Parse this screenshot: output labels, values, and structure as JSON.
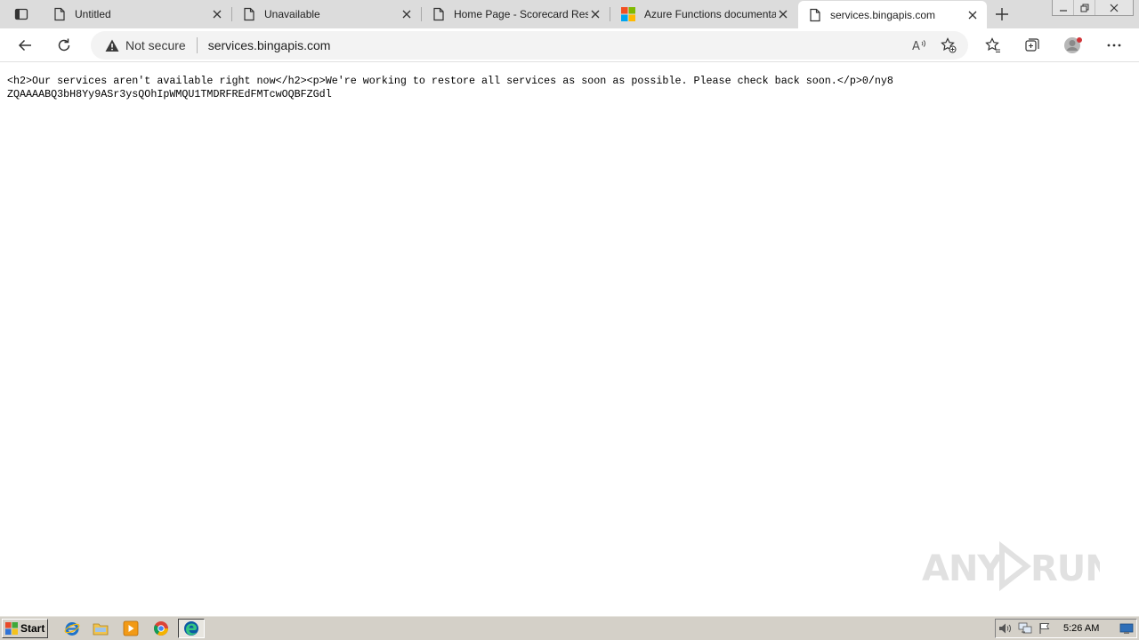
{
  "browser": {
    "tabs": [
      {
        "title": "Untitled",
        "icon": "page-icon",
        "active": false
      },
      {
        "title": "Unavailable",
        "icon": "page-icon",
        "active": false
      },
      {
        "title": "Home Page - Scorecard Res",
        "icon": "page-icon",
        "active": false
      },
      {
        "title": "Azure Functions documenta",
        "icon": "microsoft-logo-icon",
        "active": false
      },
      {
        "title": "services.bingapis.com",
        "icon": "page-icon",
        "active": true
      }
    ],
    "omnibox": {
      "security_label": "Not secure",
      "url": "services.bingapis.com"
    }
  },
  "page": {
    "raw_response": "<h2>Our services aren't available right now</h2><p>We're working to restore all services as soon as possible. Please check back soon.</p>0/ny8ZQAAAABQ3bH8Yy9ASr3ysQOhIpWMQU1TMDRFREdFMTcwOQBFZGdl"
  },
  "watermark": {
    "text": "ANY RUN"
  },
  "taskbar": {
    "start_label": "Start",
    "clock": "5:26 AM",
    "quick_launch": [
      "internet-explorer-icon",
      "folder-icon",
      "media-player-icon",
      "chrome-icon",
      "edge-icon"
    ]
  },
  "colors": {
    "edge_accent": "#0c59a4",
    "taskbar": "#d4d0c8",
    "tabstrip": "#dcdcdc"
  }
}
